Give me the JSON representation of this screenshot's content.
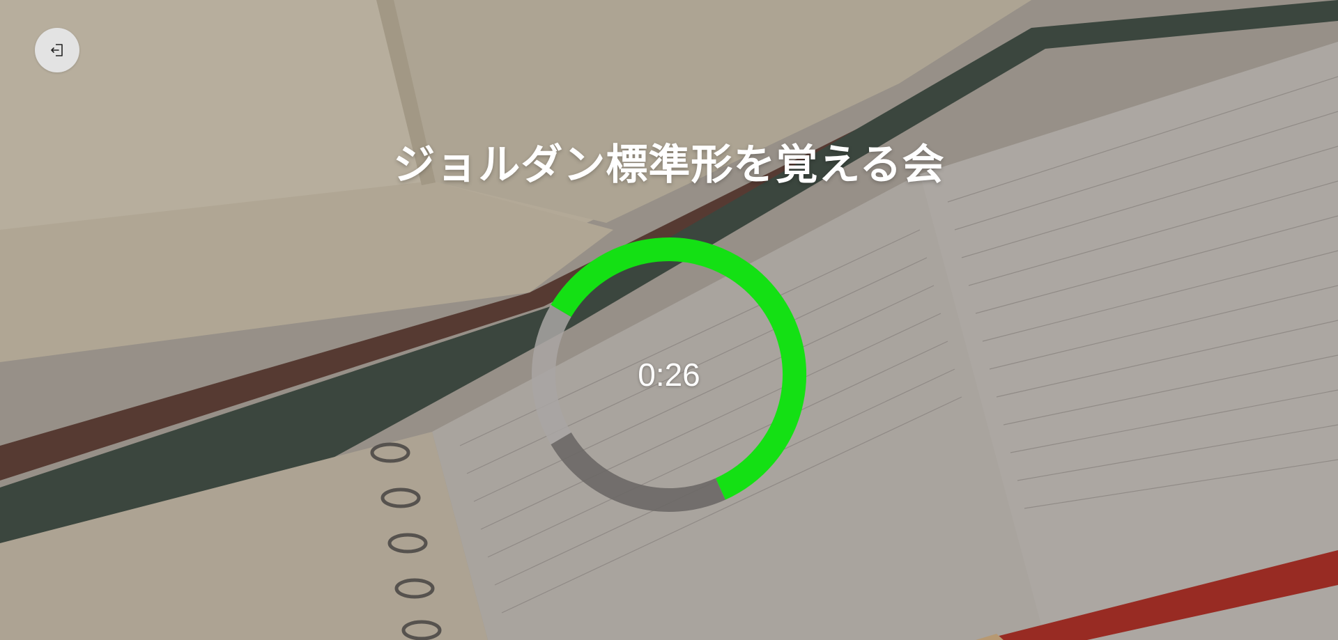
{
  "header": {
    "exit_icon": "exit-icon"
  },
  "session": {
    "title": "ジョルダン標準形を覚える会"
  },
  "timer": {
    "display": "0:26",
    "progress": 0.72,
    "track_fraction": 0.83,
    "progress_color": "#14e014",
    "remaining_color": "#6b6866",
    "gap_color": "#a9a6a3"
  }
}
